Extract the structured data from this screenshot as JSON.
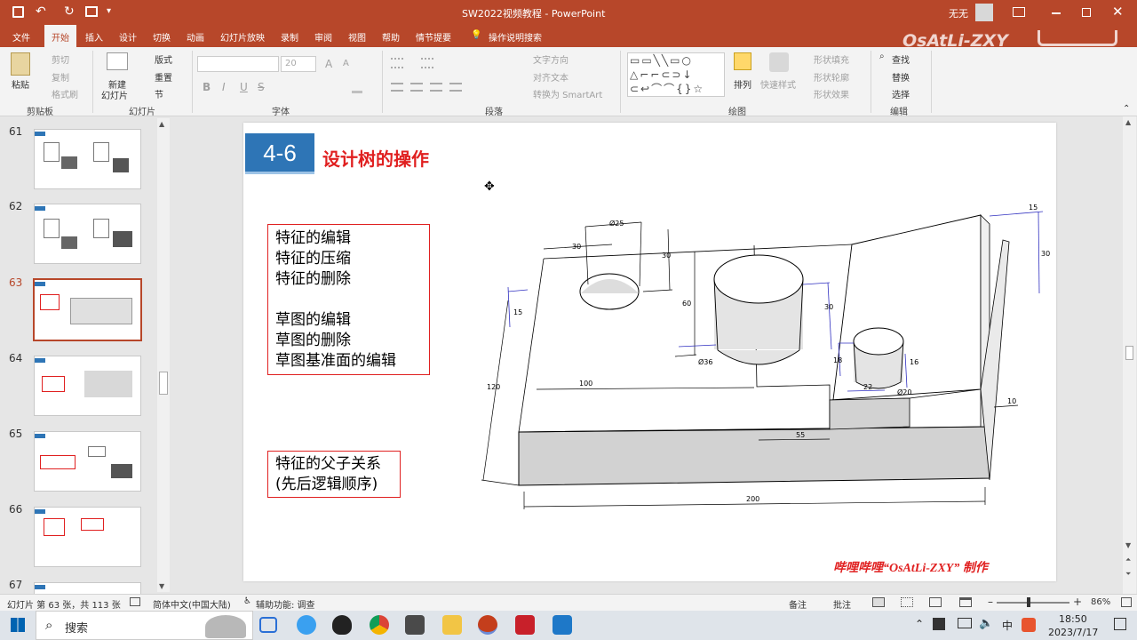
{
  "app": {
    "title": "SW2022视频教程 - PowerPoint",
    "user": "无无",
    "watermark": "OsAtLi-ZXY"
  },
  "qat": {
    "save": "💾",
    "undo": "↶",
    "redo": "↻",
    "more": "▾"
  },
  "tabs": [
    "文件",
    "开始",
    "插入",
    "设计",
    "切换",
    "动画",
    "幻灯片放映",
    "录制",
    "审阅",
    "视图",
    "帮助",
    "情节提要"
  ],
  "search_label": "操作说明搜索",
  "ribbon": {
    "clipboard": {
      "paste": "粘贴",
      "cut": "剪切",
      "copy": "复制",
      "format_painter": "格式刷",
      "group": "剪贴板"
    },
    "slides": {
      "new_slide_1": "新建",
      "new_slide_2": "幻灯片",
      "layout": "版式",
      "reset": "重置",
      "section": "节",
      "group": "幻灯片"
    },
    "font": {
      "size": "20",
      "group": "字体",
      "bold": "B",
      "italic": "I",
      "underline": "U",
      "strike": "S",
      "grow": "A",
      "shrink": "A"
    },
    "paragraph": {
      "text_direction": "文字方向",
      "align_text": "对齐文本",
      "smartart": "转换为 SmartArt",
      "group": "段落"
    },
    "drawing": {
      "arrange": "排列",
      "quick_styles": "快速样式",
      "fill": "形状填充",
      "outline": "形状轮廓",
      "effects": "形状效果",
      "group": "绘图"
    },
    "editing": {
      "find": "查找",
      "replace": "替换",
      "select": "选择",
      "group": "编辑"
    }
  },
  "thumbs": [
    {
      "n": "61"
    },
    {
      "n": "62"
    },
    {
      "n": "63"
    },
    {
      "n": "64"
    },
    {
      "n": "65"
    },
    {
      "n": "66"
    },
    {
      "n": "67"
    }
  ],
  "slide": {
    "badge": "4-6",
    "title": "设计树的操作",
    "box1": [
      "特征的编辑",
      "特征的压缩",
      "特征的删除",
      "",
      "草图的编辑",
      "草图的删除",
      "草图基准面的编辑"
    ],
    "box2": [
      "特征的父子关系",
      "(先后逻辑顺序)"
    ],
    "footer": "哔哩哔哩“OsAtLi-ZXY” 制作",
    "dims": {
      "d25": "Ø25",
      "d30a": "30",
      "d30b": "30",
      "d60": "60",
      "d15a": "15",
      "d120": "120",
      "d100": "100",
      "d36": "Ø36",
      "d30c": "30",
      "d15b": "15",
      "d30d": "30",
      "d18": "18",
      "d16": "16",
      "d22": "22",
      "d20": "Ø20",
      "d10": "10",
      "d55": "55",
      "d200": "200"
    }
  },
  "status": {
    "slide_info": "幻灯片 第 63 张，共 113 张",
    "language": "简体中文(中国大陆)",
    "accessibility": "辅助功能: 调查",
    "notes": "备注",
    "comments": "批注",
    "zoom": "86%"
  },
  "taskbar": {
    "search": "搜索",
    "time": "18:50",
    "date": "2023/7/17",
    "ime": "中"
  },
  "colors": {
    "accent": "#b7472a",
    "badge": "#2e75b6",
    "red": "#e02020",
    "dim": "#3030c0"
  }
}
